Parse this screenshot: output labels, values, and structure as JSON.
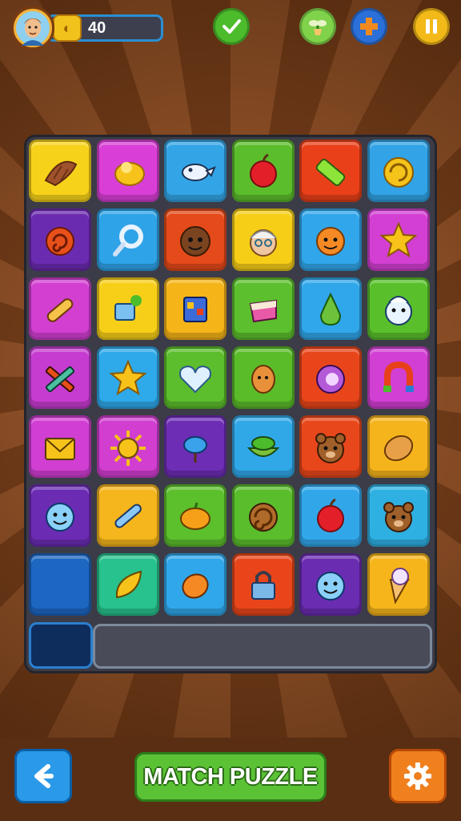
{
  "hud": {
    "coins": "40",
    "coin_glyph": "◐",
    "buttons": [
      {
        "name": "checkmark-button",
        "icon": "check-icon",
        "color": "#4cbb2c"
      },
      {
        "name": "sprout-button",
        "icon": "sprout-icon",
        "color": "#7fd24a"
      },
      {
        "name": "add-button",
        "icon": "plus-icon",
        "color": "#2b6fd8"
      },
      {
        "name": "pause-button",
        "icon": "pause-icon",
        "color": "#f2b918"
      }
    ]
  },
  "board": {
    "rows": 7,
    "cols": 6,
    "tiles": [
      [
        "croissant",
        "lemon-slice",
        "bird",
        "apple",
        "battery",
        "swirl-shell"
      ],
      [
        "spiral-snail",
        "ring-key",
        "monkey-face",
        "grandma-face",
        "orange-face",
        "star"
      ],
      [
        "rolling-pin",
        "watering-can",
        "cube-toy",
        "cake-slice",
        "pear",
        "snowman-face"
      ],
      [
        "crossed-pencils",
        "star",
        "heart",
        "potato-face",
        "purple-swirl",
        "magnet"
      ],
      [
        "broken-envelope",
        "sun-splat",
        "fish",
        "lime-bowl",
        "bear-face",
        "bread"
      ],
      [
        "smile-face",
        "brush",
        "pumpkin",
        "cinnamon-roll",
        "apple",
        "bear-face"
      ],
      [
        "empty",
        "leaf",
        "orange-fruit",
        "padlock",
        "smile-face",
        "ice-cream"
      ]
    ],
    "colors": [
      [
        "#f7d21a",
        "#d93fd6",
        "#33a5e6",
        "#5cbd2c",
        "#ea4019",
        "#31a3e6"
      ],
      [
        "#6b2bb0",
        "#2fa3e8",
        "#e54a1a",
        "#f6ce18",
        "#31a6ea",
        "#d33fd3"
      ],
      [
        "#d23fd1",
        "#f7cf18",
        "#f5b418",
        "#5cbf2d",
        "#30a7ea",
        "#59c02b"
      ],
      [
        "#c63cd0",
        "#2ea9ea",
        "#5cbe2c",
        "#5bbc2a",
        "#e8461a",
        "#d23fd3"
      ],
      [
        "#d03ed2",
        "#d13ed0",
        "#6d2db4",
        "#30a8e8",
        "#e8471b",
        "#f6b41c"
      ],
      [
        "#6b2cb3",
        "#f5b51c",
        "#5cbf2c",
        "#5abd2c",
        "#31a7ea",
        "#2eb0e2"
      ],
      [
        "#1d66c2",
        "#27c28d",
        "#30a7ea",
        "#e8461a",
        "#6a2cb1",
        "#f6b51b"
      ]
    ]
  },
  "footer": {
    "title": "MATCH PUZZLE"
  }
}
